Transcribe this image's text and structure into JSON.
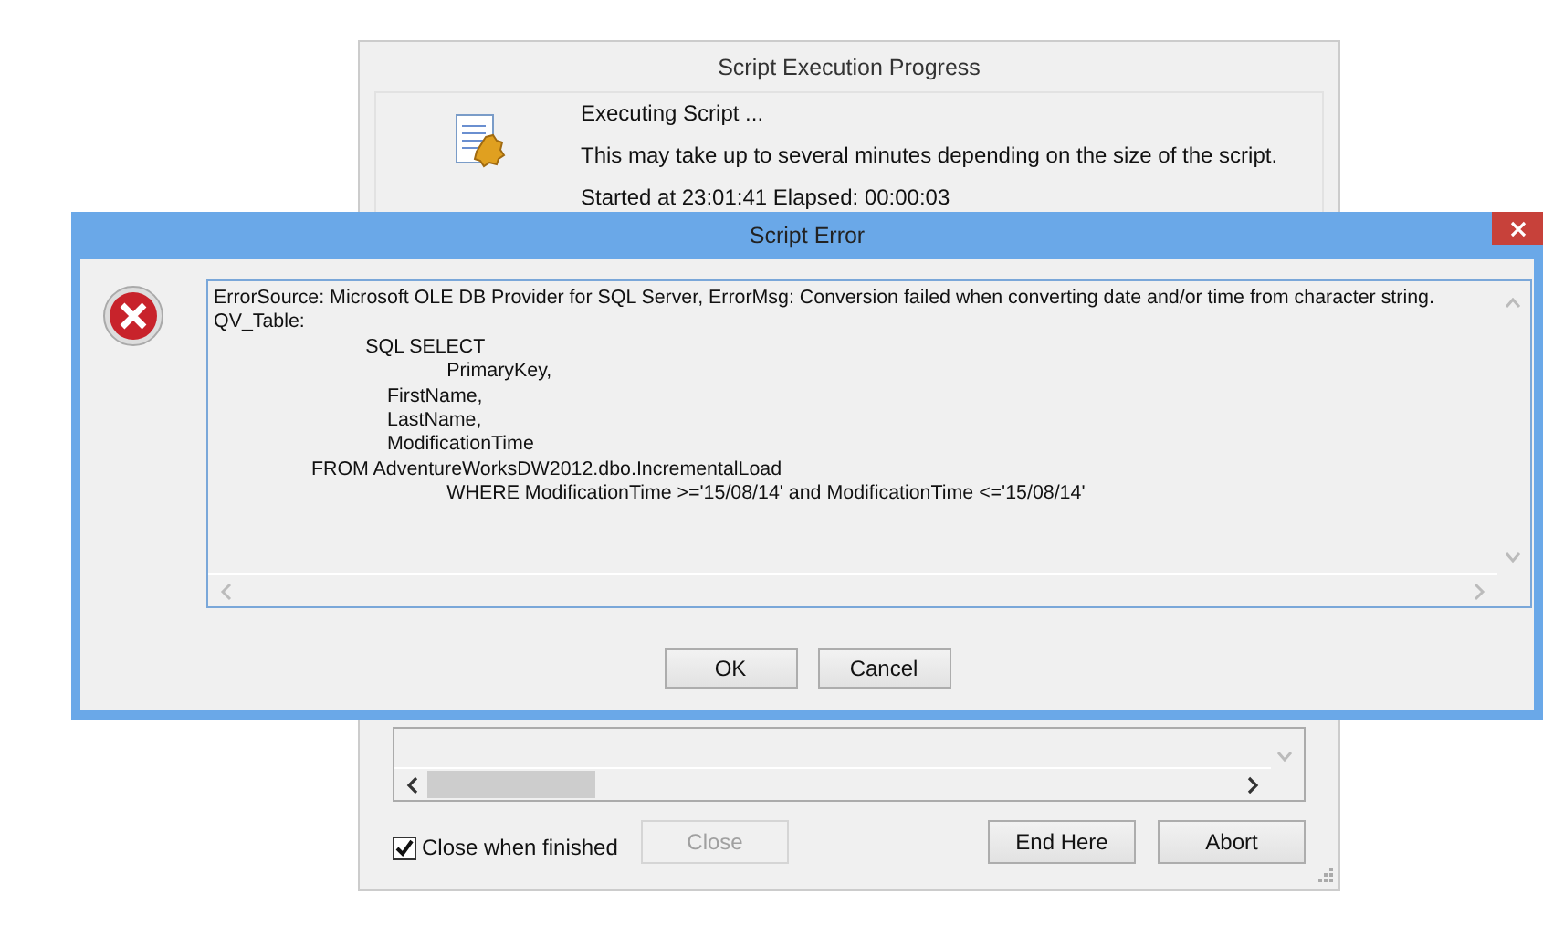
{
  "progress_window": {
    "title": "Script Execution Progress",
    "heading": "Executing Script ...",
    "note": "This may take up to several minutes depending on the size of the script.",
    "status": "Started at 23:01:41  Elapsed: 00:00:03",
    "close_when_finished": {
      "label": "Close when finished",
      "checked": true
    },
    "buttons": [
      {
        "label": "Close",
        "disabled": true
      },
      {
        "label": "End Here",
        "disabled": false
      },
      {
        "label": "Abort",
        "disabled": false
      }
    ]
  },
  "error_dialog": {
    "title": "Script Error",
    "message": "ErrorSource: Microsoft OLE DB Provider for SQL Server, ErrorMsg: Conversion failed when converting date and/or time from character string.\nQV_Table:\n                            SQL SELECT\n                                           PrimaryKey,\n                                FirstName,\n                                LastName,\n                                ModificationTime\n                  FROM AdventureWorksDW2012.dbo.IncrementalLoad\n                                           WHERE ModificationTime >='15/08/14' and ModificationTime <='15/08/14'",
    "buttons": [
      "OK",
      "Cancel"
    ]
  }
}
